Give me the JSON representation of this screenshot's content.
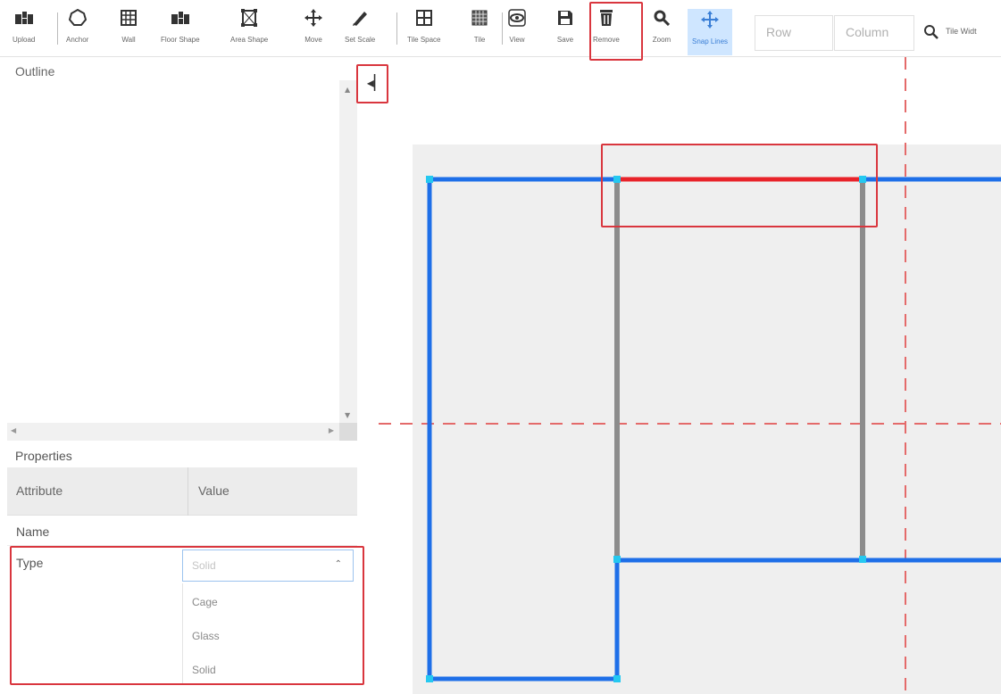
{
  "toolbar": {
    "tools": [
      {
        "id": "upload",
        "label": "Upload",
        "icon": "upload-icon"
      },
      {
        "id": "anchor",
        "label": "Anchor",
        "icon": "anchor-icon"
      },
      {
        "id": "wall",
        "label": "Wall",
        "icon": "wall-icon"
      },
      {
        "id": "floor_shape",
        "label": "Floor Shape",
        "icon": "floor-shape-icon"
      },
      {
        "id": "area_shape",
        "label": "Area Shape",
        "icon": "area-shape-icon"
      },
      {
        "id": "move",
        "label": "Move",
        "icon": "move-icon"
      },
      {
        "id": "set_scale",
        "label": "Set Scale",
        "icon": "pencil-icon"
      },
      {
        "id": "tile_space",
        "label": "Tile Space",
        "icon": "tile-space-icon"
      },
      {
        "id": "tile",
        "label": "Tile",
        "icon": "tile-icon"
      },
      {
        "id": "view",
        "label": "View",
        "icon": "eye-icon"
      },
      {
        "id": "save",
        "label": "Save",
        "icon": "floppy-icon"
      },
      {
        "id": "remove",
        "label": "Remove",
        "icon": "trash-icon"
      },
      {
        "id": "zoom",
        "label": "Zoom",
        "icon": "zoom-icon"
      },
      {
        "id": "snap_lines",
        "label": "Snap Lines",
        "icon": "snap-lines-icon",
        "active": true
      }
    ],
    "row_placeholder": "Row",
    "column_placeholder": "Column",
    "search_label": "Tile Widt"
  },
  "outline": {
    "label": "Outline"
  },
  "properties": {
    "label": "Properties",
    "col_attribute": "Attribute",
    "col_value": "Value",
    "rows": {
      "name": "Name",
      "type": "Type"
    },
    "type_value": "Solid",
    "type_options": [
      "Cage",
      "Glass",
      "Solid"
    ]
  },
  "colors": {
    "accent": "#1e6fe8",
    "highlight": "#d9363e",
    "wall_gray": "#8c8c8c",
    "selected_wall": "#e8232a",
    "guide": "#e46a6a",
    "vertex": "#25c8f0",
    "floor_fill": "#efefef",
    "active_tool_bg": "#cfe6ff"
  }
}
